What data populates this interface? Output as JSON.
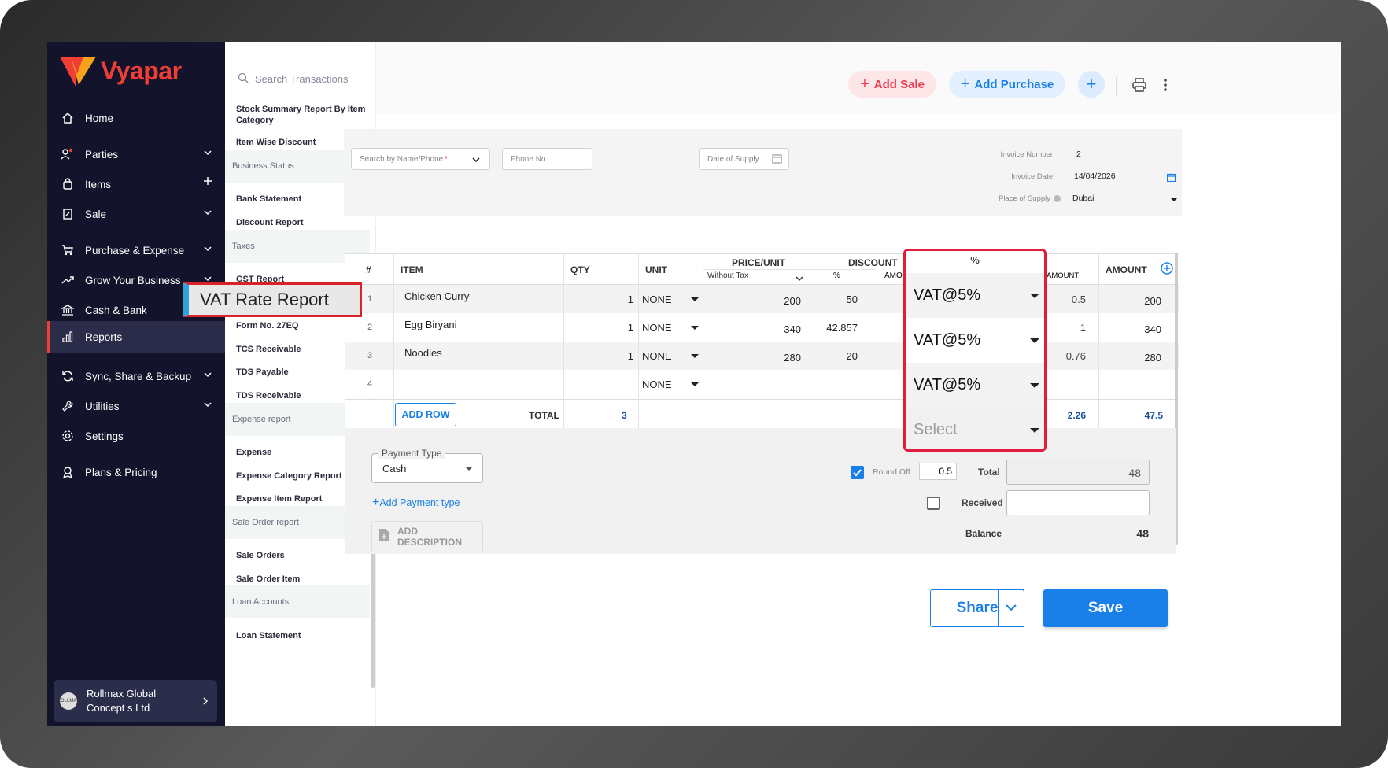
{
  "app": {
    "brand": "Vyapar"
  },
  "sidebar": {
    "items": [
      {
        "label": "Home"
      },
      {
        "label": "Parties"
      },
      {
        "label": "Items"
      },
      {
        "label": "Sale"
      },
      {
        "label": "Purchase & Expense"
      },
      {
        "label": "Grow Your Business"
      },
      {
        "label": "Cash & Bank"
      },
      {
        "label": "Reports"
      },
      {
        "label": "Sync, Share & Backup"
      },
      {
        "label": "Utilities"
      },
      {
        "label": "Settings"
      },
      {
        "label": "Plans & Pricing"
      }
    ],
    "company": {
      "name": "Rollmax Global Concept s Ltd",
      "avatar_text": "ROLLMAX"
    }
  },
  "submenu": {
    "search_placeholder": "Search Transactions",
    "items": [
      "Stock Summary Report By Item Category",
      "Item Wise Discount",
      "Business Status",
      "Bank Statement",
      "Discount Report",
      "Taxes",
      "GST Report",
      "Form No. 27EQ",
      "TCS Receivable",
      "TDS Payable",
      "TDS Receivable",
      "Expense report",
      "Expense",
      "Expense Category Report",
      "Expense Item Report",
      "Sale Order report",
      "Sale Orders",
      "Sale Order Item",
      "Loan Accounts",
      "Loan Statement"
    ],
    "callout": "VAT Rate Report"
  },
  "topbar": {
    "add_sale": "Add Sale",
    "add_purchase": "Add Purchase"
  },
  "invoice": {
    "party_placeholder": "Search by Name/Phone",
    "phone_placeholder": "Phone No.",
    "supply_date_placeholder": "Date of Supply",
    "invoice_number_label": "Invoice Number",
    "invoice_number": "2",
    "invoice_date_label": "Invoice Date",
    "invoice_date": "14/04/2026",
    "place_label": "Place of Supply",
    "place": "Dubai"
  },
  "table": {
    "headers": {
      "num": "#",
      "item": "ITEM",
      "qty": "QTY",
      "unit": "UNIT",
      "price": "PRICE/UNIT",
      "price_sub": "Without Tax",
      "discount": "DISCOUNT",
      "disc_pct": "%",
      "disc_amt": "AMOUNT",
      "tax_amt": "AMOUNT",
      "amount": "AMOUNT"
    },
    "rows": [
      {
        "num": "1",
        "item": "Chicken Curry",
        "qty": "1",
        "unit": "NONE",
        "price": "200",
        "disc_pct": "50",
        "tax_amt": "0.5",
        "amount": "200"
      },
      {
        "num": "2",
        "item": "Egg Biryani",
        "qty": "1",
        "unit": "NONE",
        "price": "340",
        "disc_pct": "42.857",
        "tax_amt": "1",
        "amount": "340"
      },
      {
        "num": "3",
        "item": "Noodles",
        "qty": "1",
        "unit": "NONE",
        "price": "280",
        "disc_pct": "20",
        "tax_amt": "0.76",
        "amount": "280"
      },
      {
        "num": "4",
        "item": "",
        "qty": "",
        "unit": "NONE",
        "price": "",
        "disc_pct": "",
        "tax_amt": "",
        "amount": ""
      }
    ],
    "add_row": "ADD ROW",
    "total_label": "TOTAL",
    "total_qty": "3",
    "total_tax": "2.26",
    "total_amount": "47.5"
  },
  "vat_dropdown": {
    "header": "%",
    "options": [
      "VAT@5%",
      "VAT@5%",
      "VAT@5%",
      "Select"
    ]
  },
  "payment": {
    "type_label": "Payment Type",
    "type_value": "Cash",
    "add_payment": "Add Payment type",
    "add_description": "ADD DESCRIPTION",
    "round_off_label": "Round Off",
    "round_off_value": "0.5",
    "total_label": "Total",
    "total_value": "48",
    "received_label": "Received",
    "balance_label": "Balance",
    "balance_value": "48"
  },
  "actions": {
    "share": "Share",
    "save": "Save"
  }
}
